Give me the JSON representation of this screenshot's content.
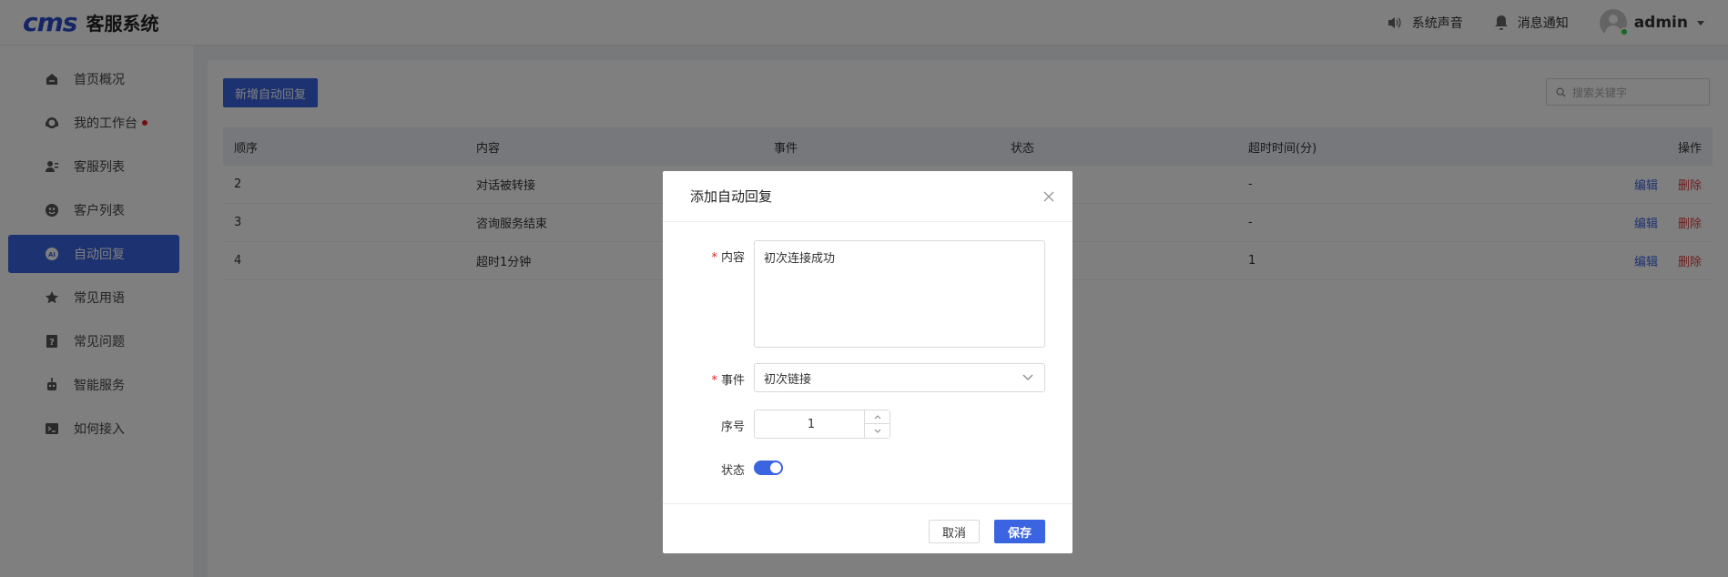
{
  "header": {
    "logo": "cms",
    "title": "客服系统",
    "sound_label": "系统声音",
    "notify_label": "消息通知",
    "username": "admin"
  },
  "sidebar": {
    "items": [
      {
        "label": "首页概况",
        "icon": "home-icon"
      },
      {
        "label": "我的工作台",
        "icon": "headset-icon",
        "badge_dot": true
      },
      {
        "label": "客服列表",
        "icon": "user-list-icon"
      },
      {
        "label": "客户列表",
        "icon": "customer-icon"
      },
      {
        "label": "自动回复",
        "icon": "auto-reply-icon",
        "active": true
      },
      {
        "label": "常见用语",
        "icon": "star-icon"
      },
      {
        "label": "常见问题",
        "icon": "question-icon"
      },
      {
        "label": "智能服务",
        "icon": "robot-icon"
      },
      {
        "label": "如何接入",
        "icon": "terminal-icon"
      }
    ]
  },
  "toolbar": {
    "add_label": "新增自动回复",
    "search_placeholder": "搜索关键字"
  },
  "table": {
    "headers": [
      "顺序",
      "内容",
      "事件",
      "状态",
      "超时时间(分)",
      "操作"
    ],
    "rows": [
      {
        "seq": "2",
        "content": "对话被转接",
        "timeout": "-"
      },
      {
        "seq": "3",
        "content": "咨询服务结束",
        "timeout": "-"
      },
      {
        "seq": "4",
        "content": "超时1分钟",
        "timeout": "1"
      }
    ],
    "edit_label": "编辑",
    "delete_label": "删除"
  },
  "modal": {
    "title": "添加自动回复",
    "content_label": "内容",
    "content_value": "初次连接成功",
    "event_label": "事件",
    "event_value": "初次链接",
    "order_label": "序号",
    "order_value": "1",
    "status_label": "状态",
    "status_on": true,
    "cancel_label": "取消",
    "save_label": "保存"
  },
  "colors": {
    "primary": "#3b64e0",
    "danger": "#e04040",
    "online": "#2ecc40"
  }
}
